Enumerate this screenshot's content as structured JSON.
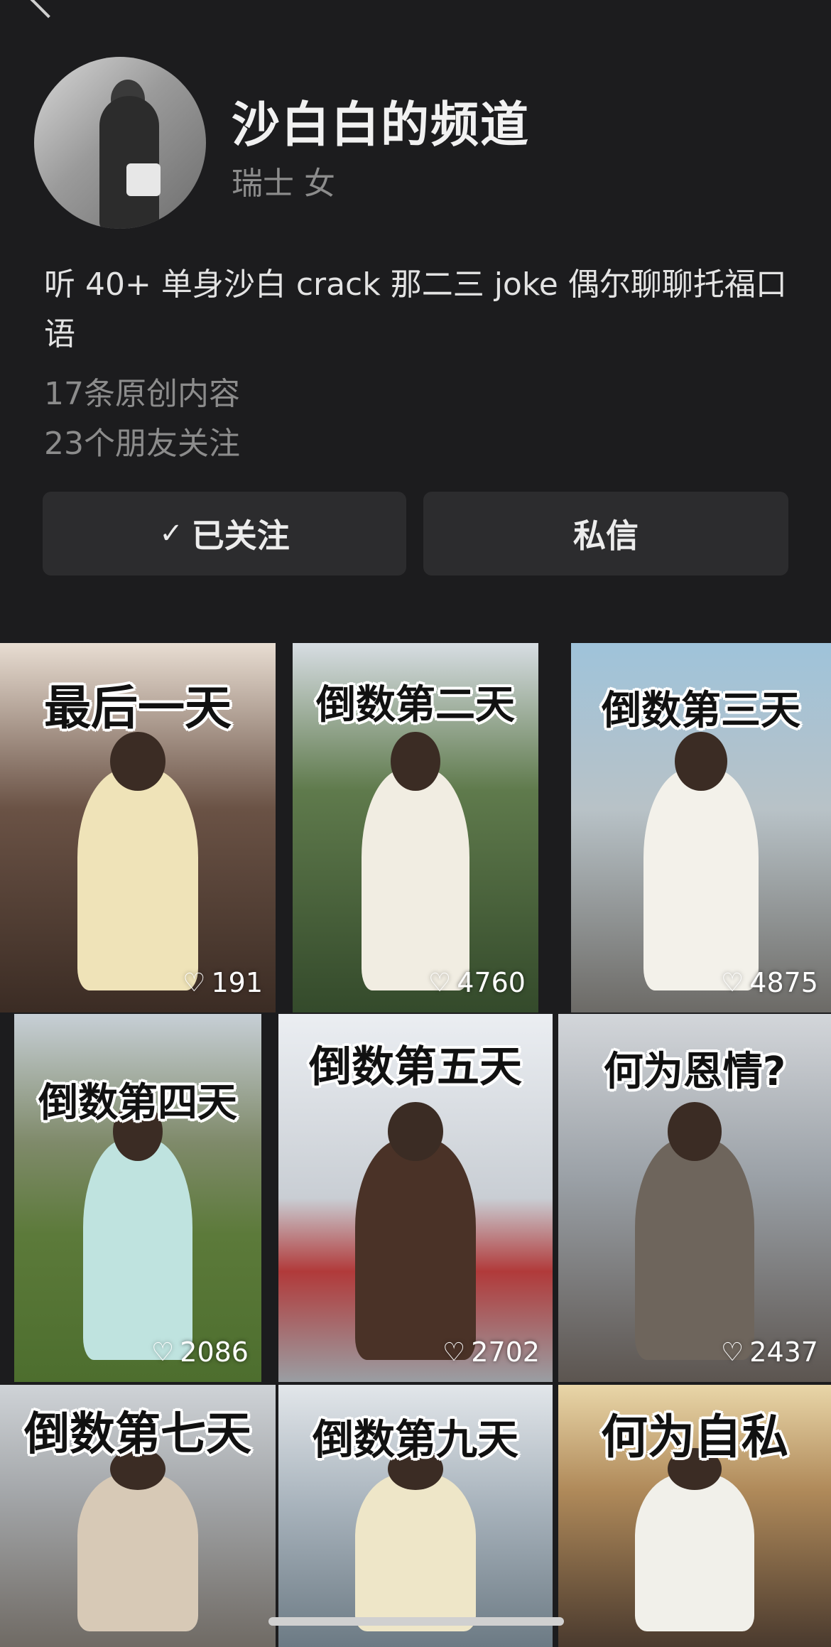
{
  "profile": {
    "name": "沙白白的频道",
    "meta": "瑞士 女",
    "bio": "听 40+ 单身沙白 crack 那二三 joke 偶尔聊聊托福口语",
    "original_count": "17条原创内容",
    "friends_following": "23个朋友关注"
  },
  "actions": {
    "followed_check": "✓",
    "followed_label": "已关注",
    "message_label": "私信"
  },
  "videos": [
    {
      "caption": "最后一天",
      "likes": "191"
    },
    {
      "caption": "倒数第二天",
      "likes": "4760"
    },
    {
      "caption": "倒数第三天",
      "likes": "4875"
    },
    {
      "caption": "倒数第四天",
      "likes": "2086"
    },
    {
      "caption": "倒数第五天",
      "likes": "2702"
    },
    {
      "caption": "何为恩情?",
      "likes": "2437"
    },
    {
      "caption": "倒数第七天",
      "likes": ""
    },
    {
      "caption": "倒数第九天",
      "likes": ""
    },
    {
      "caption": "何为自私",
      "likes": ""
    }
  ],
  "icons": {
    "heart": "♡",
    "back": "chevron-left"
  }
}
